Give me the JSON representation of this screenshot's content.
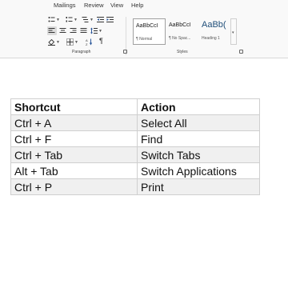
{
  "ribbon": {
    "menu": [
      "Mailings",
      "Review",
      "View",
      "Help"
    ],
    "styles": [
      {
        "sample": "AaBbCcI",
        "name": "¶ Normal"
      },
      {
        "sample": "AaBbCcI",
        "name": "¶ No Spac..."
      },
      {
        "sample": "AaBb(",
        "name": "Heading 1"
      }
    ],
    "groups": {
      "paragraph": "Paragraph",
      "styles": "Styles"
    },
    "icons": {
      "bullets": "bullet-list-icon",
      "numbering": "numbered-list-icon",
      "multilevel": "multilevel-list-icon",
      "decrease_indent": "decrease-indent-icon",
      "increase_indent": "increase-indent-icon",
      "align_left": "align-left-icon",
      "center": "align-center-icon",
      "align_right": "align-right-icon",
      "justify": "justify-icon",
      "line_spacing": "line-spacing-icon",
      "shading": "shading-icon",
      "borders": "borders-icon",
      "sort": "sort-icon",
      "pilcrow": "show-formatting-icon"
    },
    "pilcrow": "¶",
    "sort_glyph": "↓"
  },
  "table": {
    "headers": [
      "Shortcut",
      "Action"
    ],
    "rows": [
      [
        "Ctrl + A",
        "Select All"
      ],
      [
        "Ctrl + F",
        "Find"
      ],
      [
        "Ctrl + Tab",
        "Switch Tabs"
      ],
      [
        "Alt + Tab",
        "Switch Applications"
      ],
      [
        "Ctrl + P",
        "Print"
      ]
    ]
  }
}
